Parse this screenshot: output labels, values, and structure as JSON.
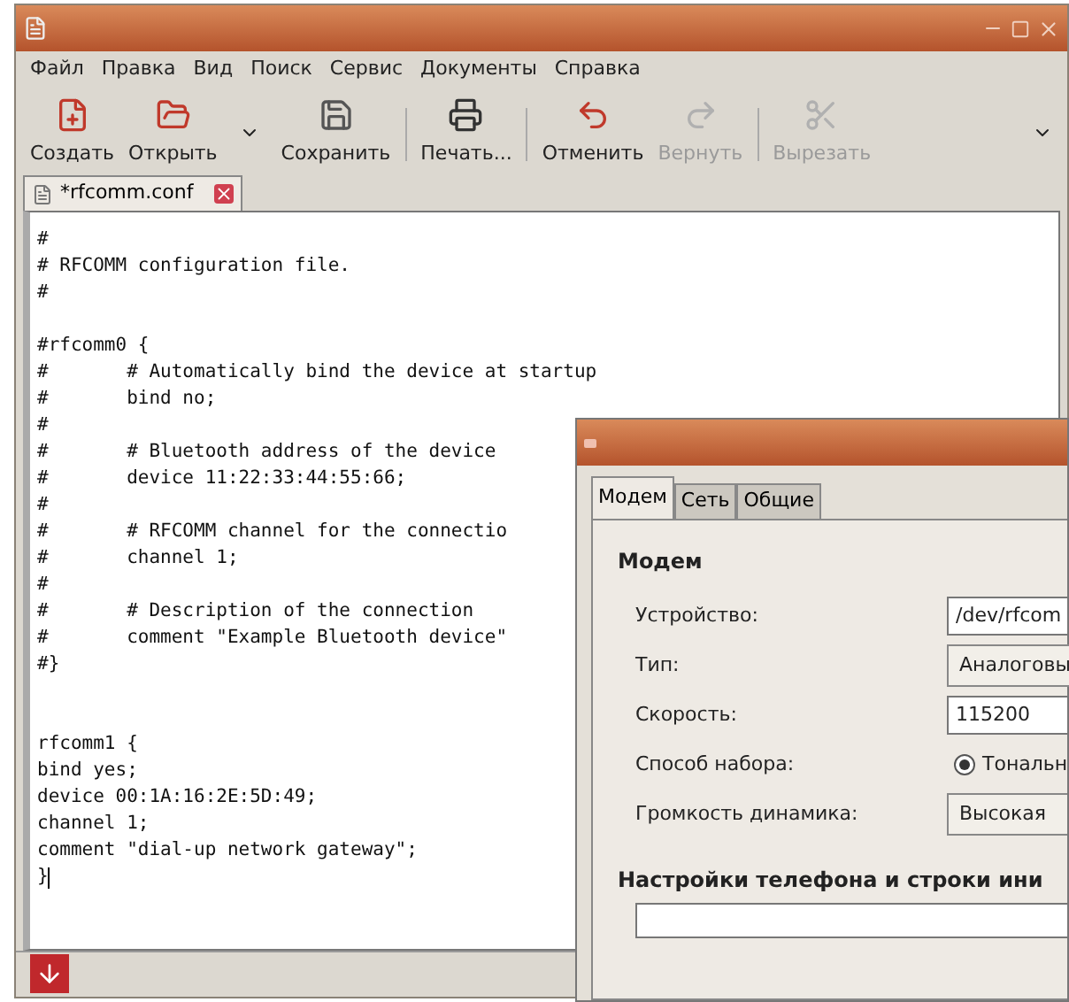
{
  "menu": [
    "Файл",
    "Правка",
    "Вид",
    "Поиск",
    "Сервис",
    "Документы",
    "Справка"
  ],
  "toolbar": [
    {
      "kind": "new",
      "label": "Создать",
      "disabled": false
    },
    {
      "kind": "open",
      "label": "Открыть",
      "disabled": false
    },
    {
      "kind": "save",
      "label": "Сохранить",
      "disabled": false
    },
    {
      "kind": "print",
      "label": "Печать...",
      "disabled": false
    },
    {
      "kind": "undo",
      "label": "Отменить",
      "disabled": false
    },
    {
      "kind": "redo",
      "label": "Вернуть",
      "disabled": true
    },
    {
      "kind": "cut",
      "label": "Вырезать",
      "disabled": true
    }
  ],
  "document_tab": {
    "label": "*rfcomm.conf",
    "selected": true
  },
  "editor": {
    "blocks": [
      [
        "#",
        "# RFCOMM configuration file.",
        "#"
      ],
      [
        "#rfcomm0 {",
        "#\t# Automatically bind the device at startup",
        "#\tbind no;",
        "#",
        "#\t# Bluetooth address of the device",
        "#\tdevice 11:22:33:44:55:66;",
        "#",
        "#\t# RFCOMM channel for the connectio",
        "#\tchannel 1;",
        "#",
        "#\t# Description of the connection",
        "#\tcomment \"Example Bluetooth device\"",
        "#}"
      ],
      [
        "rfcomm1 {",
        "bind yes;",
        "device 00:1A:16:2E:5D:49;",
        "channel 1;",
        "comment \"dial-up network gateway\";",
        "}"
      ]
    ]
  },
  "dialog": {
    "tabs": [
      {
        "label": "Модем",
        "selected": true
      },
      {
        "label": "Сеть",
        "selected": false
      },
      {
        "label": "Общие",
        "selected": false
      }
    ],
    "section": "Модем",
    "fields": [
      {
        "kind": "entry",
        "label": "Устройство:",
        "value": "/dev/rfcom"
      },
      {
        "kind": "combo",
        "label": "Тип:",
        "value": "Аналоговы"
      },
      {
        "kind": "entry",
        "label": "Скорость:",
        "value": "115200"
      },
      {
        "kind": "radio",
        "label": "Способ набора:",
        "value": "Тональн",
        "checked": true
      },
      {
        "kind": "combo",
        "label": "Громкость динамика:",
        "value": "Высокая"
      }
    ],
    "section_2": "Настройки телефона и строки ини"
  }
}
